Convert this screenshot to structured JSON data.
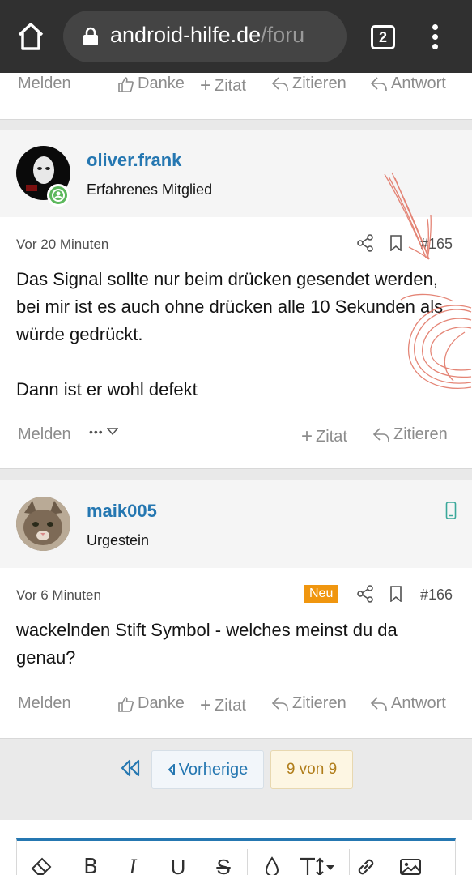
{
  "browser": {
    "url_host": "android-hilfe.de",
    "url_path": "/foru",
    "tab_count": "2",
    "icons": [
      "home-icon",
      "lock-icon",
      "more-vert-icon"
    ]
  },
  "top_actions": {
    "report": "Melden",
    "thanks": "Danke",
    "quote": "Zitat",
    "reply_quote": "Zitieren",
    "answer": "Antwort"
  },
  "posts": [
    {
      "username": "oliver.frank",
      "user_title": "Erfahrenes Mitglied",
      "time": "Vor 20 Minuten",
      "number": "#165",
      "paragraphs": [
        "Das Signal sollte nur beim drücken gesendet werden, bei mir ist es auch ohne drücken alle 10 Sekunden als würde gedrückt.",
        "Dann ist er wohl defekt"
      ],
      "actions": {
        "report": "Melden",
        "more": "•••",
        "quote": "Zitat",
        "reply_quote": "Zitieren"
      }
    },
    {
      "username": "maik005",
      "user_title": "Urgestein",
      "time": "Vor 6 Minuten",
      "badge": "Neu",
      "number": "#166",
      "paragraphs": [
        "wackelnden Stift Symbol - welches meinst du da genau?"
      ],
      "actions": {
        "report": "Melden",
        "thanks": "Danke",
        "quote": "Zitat",
        "reply_quote": "Zitieren",
        "answer": "Antwort"
      }
    }
  ],
  "pagination": {
    "prev_label": "Vorherige",
    "current": "9 von 9"
  },
  "editor_toolbar": [
    "eraser-icon",
    "bold-icon",
    "italic-icon",
    "underline-icon",
    "strikethrough-icon",
    "color-drop-icon",
    "text-size-icon",
    "link-icon",
    "image-icon"
  ],
  "colors": {
    "accent": "#2577b1",
    "chrome": "#303030",
    "badge_new": "#f0960f",
    "scribble": "#e0705f"
  }
}
